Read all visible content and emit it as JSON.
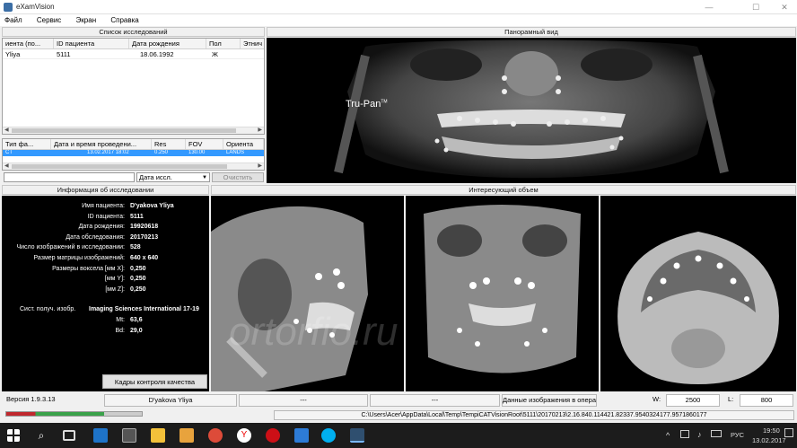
{
  "window": {
    "title": "eXamVision",
    "min_glyph": "—",
    "max_glyph": "☐",
    "close_glyph": "✕"
  },
  "menu": [
    "Файл",
    "Сервис",
    "Экран",
    "Справка"
  ],
  "study_list": {
    "header": "Список исследований",
    "columns": [
      "иента (по...",
      "ID пациента",
      "Дата рождения",
      "Пол",
      "Этнич"
    ],
    "rows": [
      [
        "Yliya",
        "5111",
        "18.06.1992",
        "Ж",
        ""
      ]
    ]
  },
  "series_list": {
    "columns": [
      "Тип фа...",
      "Дата и время проведени...",
      "Res",
      "FOV",
      "Ориента"
    ],
    "rows": [
      [
        "CT",
        "13.02.2017 18:02",
        "0.250",
        "130.00",
        "LANDS"
      ]
    ],
    "filter_select": "Дата иссл.",
    "clear_button": "Очистить"
  },
  "panorama": {
    "header": "Панорамный вид",
    "overlay": "Tru-Pan",
    "overlay_sup": "TM"
  },
  "info": {
    "header": "Информация об исследовании",
    "fields": [
      {
        "label": "Имя пациента:",
        "value": "D'yakova Yliya"
      },
      {
        "label": "ID пациента:",
        "value": "5111"
      },
      {
        "label": "Дата рождения:",
        "value": "19920618"
      },
      {
        "label": "Дата обследования:",
        "value": "20170213"
      },
      {
        "label": "Число изображений в исследовании:",
        "value": "528"
      },
      {
        "label": "Размер матрицы изображений:",
        "value": "640 x 640"
      },
      {
        "label": "Размеры вокселa [мм X]:",
        "value": "0,250"
      },
      {
        "label": "[мм Y]:",
        "value": "0,250"
      },
      {
        "label": "[мм Z]:",
        "value": "0,250"
      },
      {
        "label": "Сист. получ. изобр.",
        "value": "Imaging Sciences International 17-19"
      },
      {
        "label": "Mt:",
        "value": "63,6"
      },
      {
        "label": "Bd:",
        "value": "29,0"
      }
    ],
    "qc_button": "Кадры контроля качества"
  },
  "volume": {
    "header": "Интересующий объем",
    "watermark": "ortorfio.ru"
  },
  "status": {
    "version": "Версия 1.9.3.13",
    "patient": "D'yakova Yliya",
    "cell3": "---",
    "cell4": "---",
    "memory": "Данные изображения в оперативной памяти",
    "w_label": "W:",
    "w_value": "2500",
    "l_label": "L:",
    "l_value": "800",
    "path": "C:\\Users\\Acer\\AppData\\Local\\Temp\\TempiCATVisionRoot\\5111\\20170213\\2.16.840.114421.82337.9540324177.9571860177"
  },
  "progress_fraction": 0.72,
  "taskbar": {
    "lang": "РУС",
    "time": "19:50",
    "date": "13.02.2017",
    "icons": [
      "windows-icon",
      "search-icon",
      "task-view-icon",
      "edge-icon",
      "calculator-icon",
      "explorer-icon",
      "files-icon",
      "chrome-icon",
      "yandex-icon",
      "opera-icon",
      "mail-icon",
      "skype-icon",
      "examvision-icon"
    ]
  }
}
